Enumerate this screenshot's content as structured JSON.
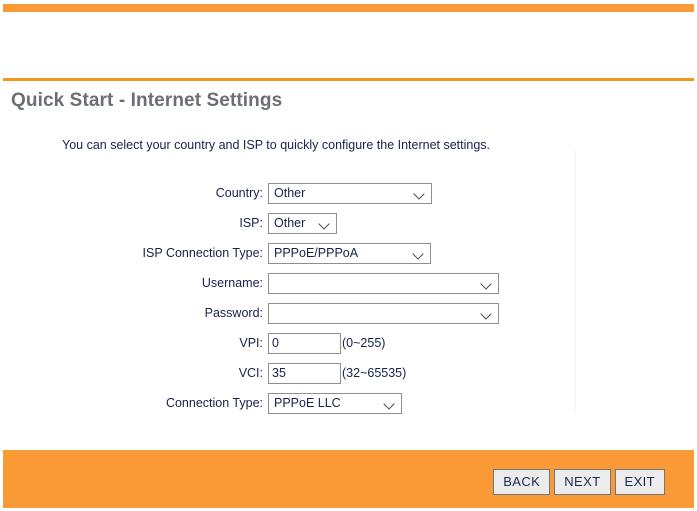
{
  "theme": {
    "accent": "#F99A36",
    "divider": "#F7941E",
    "title_color": "#6B6F74",
    "text_color": "#17224A",
    "button_bg": "#ECECEC"
  },
  "header": {
    "title": "Quick Start - Internet Settings"
  },
  "description": "You can select your country and ISP to quickly configure the Internet settings.",
  "form": {
    "rows": [
      {
        "label": "Country:",
        "type": "select",
        "value": "Other"
      },
      {
        "label": "ISP:",
        "type": "select",
        "value": "Other"
      },
      {
        "label": "ISP Connection Type:",
        "type": "select",
        "value": "PPPoE/PPPoA"
      },
      {
        "label": "Username:",
        "type": "select",
        "value": ""
      },
      {
        "label": "Password:",
        "type": "select",
        "value": ""
      },
      {
        "label": "VPI:",
        "type": "text",
        "value": "0",
        "hint": "(0~255)"
      },
      {
        "label": "VCI:",
        "type": "text",
        "value": "35",
        "hint": "(32~65535)"
      },
      {
        "label": "Connection Type:",
        "type": "select",
        "value": "PPPoE LLC"
      }
    ]
  },
  "footer": {
    "buttons": [
      {
        "label": "BACK"
      },
      {
        "label": "NEXT"
      },
      {
        "label": "EXIT"
      }
    ]
  },
  "icons": {
    "chevron": "chevron-down-icon"
  }
}
